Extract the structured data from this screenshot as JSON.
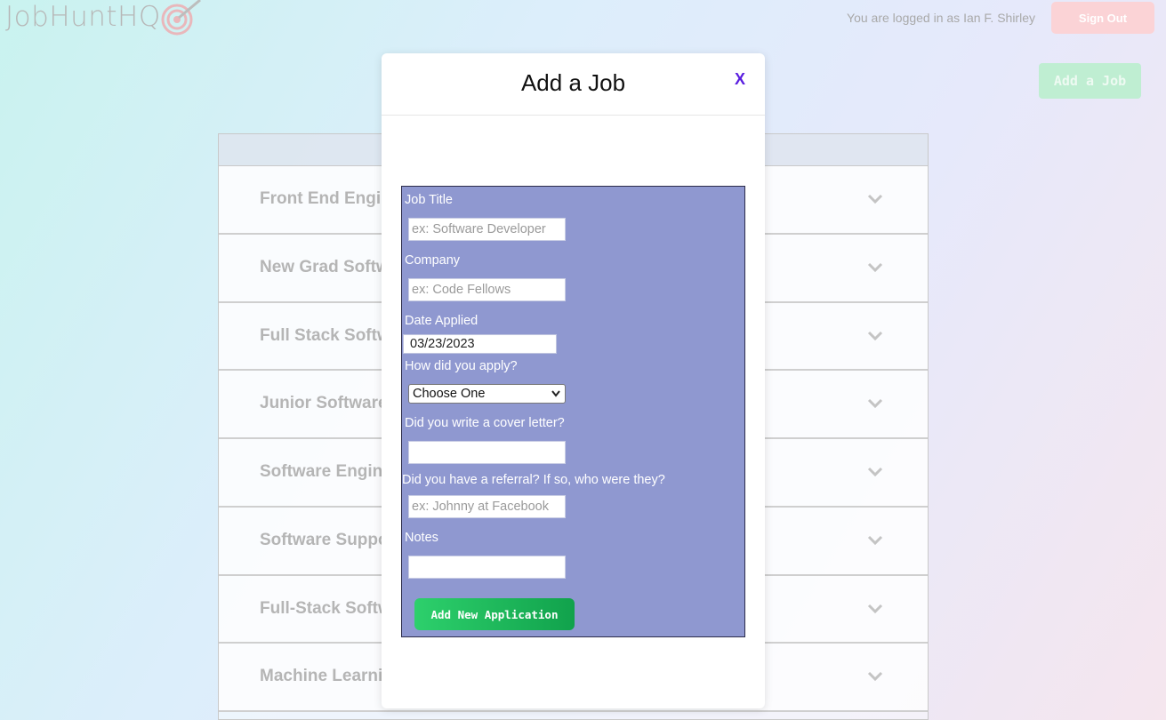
{
  "header": {
    "logo_text": "JobHuntHQ",
    "login_text": "You are logged in as Ian F. Shirley",
    "signout_label": "Sign Out",
    "add_job_label": "Add a Job"
  },
  "job_list": {
    "rows": [
      {
        "title": "Front End Engi"
      },
      {
        "title": "New Grad Softw"
      },
      {
        "title": "Full Stack Softw"
      },
      {
        "title": "Junior Software"
      },
      {
        "title": "Software Engin"
      },
      {
        "title": "Software Suppo"
      },
      {
        "title": "Full-Stack Softw"
      },
      {
        "title": "Machine Learni"
      }
    ]
  },
  "modal": {
    "title": "Add a Job",
    "close_label": "X",
    "form": {
      "job_title_label": "Job Title",
      "job_title_placeholder": "ex: Software Developer",
      "company_label": "Company",
      "company_placeholder": "ex: Code Fellows",
      "date_label": "Date Applied",
      "date_value": "03/23/2023",
      "apply_label": "How did you apply?",
      "apply_selected": "Choose One",
      "cover_letter_label": "Did you write a cover letter?",
      "referral_label": "Did you have a referral? If so, who were they?",
      "referral_placeholder": "ex: Johnny at Facebook",
      "notes_label": "Notes",
      "submit_label": "Add New Application"
    }
  },
  "colors": {
    "form_bg": "#8f98d0",
    "submit_green": "#1cb95c",
    "close_purple": "#5a1ee0",
    "signout_pink": "#fbd3d6"
  },
  "icons": {
    "logo": "target-icon",
    "row_toggle": "chevron-down-icon",
    "select": "select-arrow-icon"
  }
}
